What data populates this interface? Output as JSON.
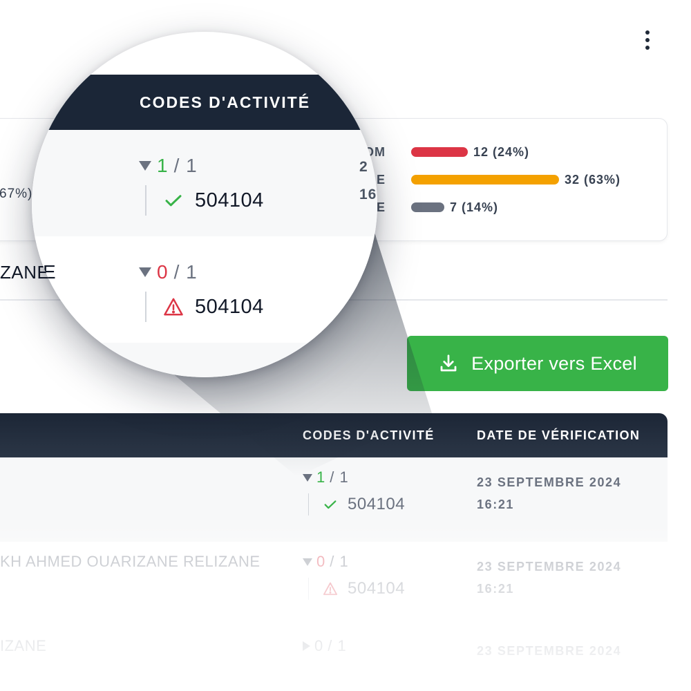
{
  "menu": {
    "icon": "more-vertical-icon"
  },
  "stats": {
    "left_fragment": "67%)",
    "rows": [
      {
        "label": "OM",
        "value": "12 (24%)",
        "fraction": 0.24,
        "color": "#dc3545"
      },
      {
        "label": "SE",
        "value": "32 (63%)",
        "fraction": 0.63,
        "color": "#f4a100"
      },
      {
        "label": "E",
        "value": "7 (14%)",
        "fraction": 0.14,
        "color": "#6b7280"
      }
    ]
  },
  "background_row": {
    "name_fragment": "ZANE"
  },
  "export_button": {
    "label": "Exporter vers Excel",
    "icon": "download-icon",
    "color": "#38b348"
  },
  "table": {
    "headers": {
      "codes": "CODES D'ACTIVITÉ",
      "date": "DATE DE VÉRIFICATION"
    },
    "rows": [
      {
        "name": "",
        "matched": "1",
        "total": "/ 1",
        "status": "ok",
        "code": "504104",
        "date": "23 SEPTEMBRE 2024",
        "time": "16:21"
      },
      {
        "name": "KH AHMED OUARIZANE RELIZANE",
        "matched": "0",
        "total": "/ 1",
        "status": "warn",
        "code": "504104",
        "date": "23 SEPTEMBRE 2024",
        "time": "16:21"
      },
      {
        "name": "IZANE",
        "matched": "0",
        "total": "/ 1",
        "status": "collapsed",
        "code": "",
        "date": "23 SEPTEMBRE 2024",
        "time": ""
      }
    ]
  },
  "magnifier": {
    "header": "CODES D'ACTIVITÉ",
    "edge_fragments": {
      "row1_name": "ZANE",
      "right_top": "2",
      "right_mid": "16"
    },
    "rows": [
      {
        "matched": "1",
        "total": "/ 1",
        "status": "ok",
        "code": "504104"
      },
      {
        "matched": "0",
        "total": "/ 1",
        "status": "warn",
        "code": "504104"
      }
    ]
  }
}
